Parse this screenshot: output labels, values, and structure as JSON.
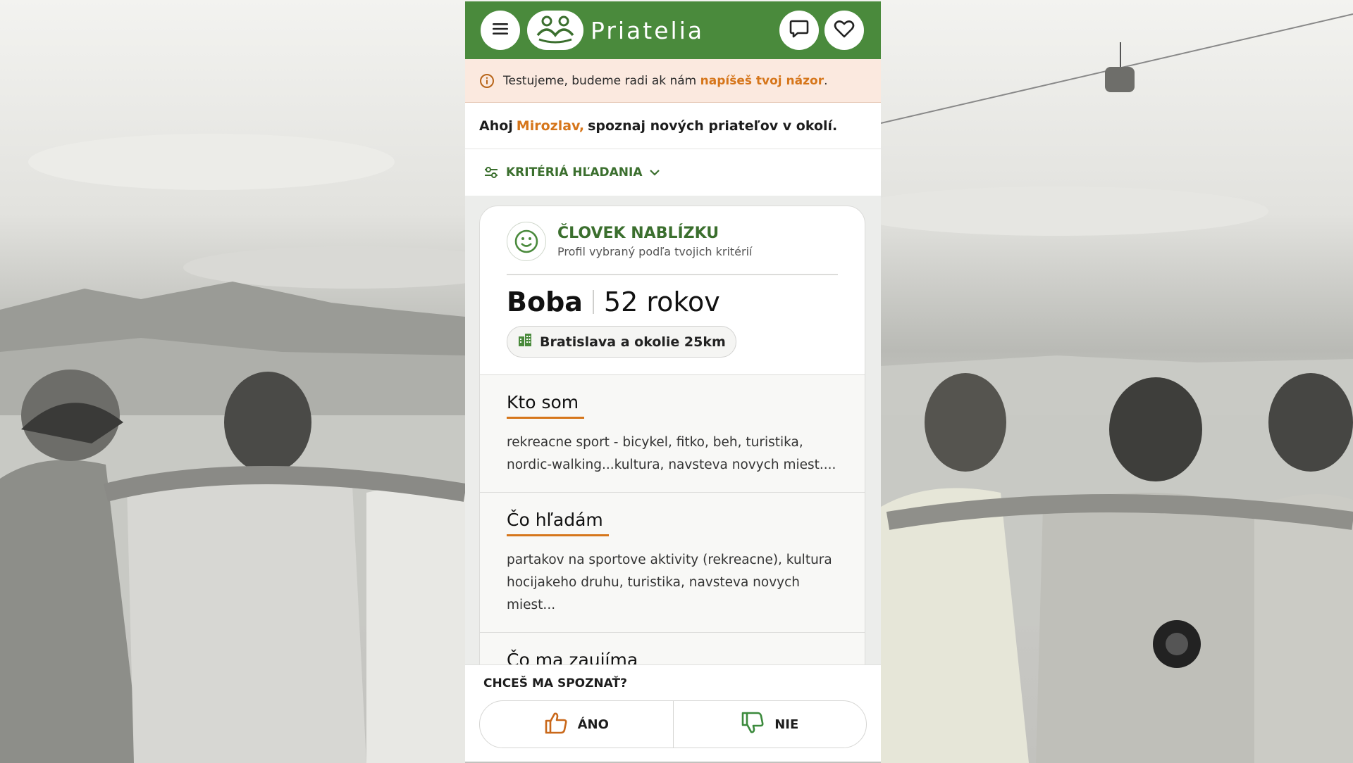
{
  "app": {
    "brand": "Priatelia",
    "colors": {
      "primary": "#4a8a3c",
      "accent": "#d6761b",
      "notice_bg": "#fbe9df"
    }
  },
  "topbar": {
    "menu_icon": "hamburger-icon",
    "logo_icon": "friends-logo-icon",
    "chat_icon": "chat-bubble-icon",
    "favorites_icon": "heart-icon"
  },
  "notice": {
    "text_before": "Testujeme, budeme radi ak nám ",
    "link": "napíšeš tvoj názor",
    "text_after": "."
  },
  "greeting": {
    "hello": "Ahoj",
    "name": "Mirozlav,",
    "rest": "spoznaj nových priateľov v okolí."
  },
  "criteria": {
    "label": "KRITÉRIÁ HĽADANIA"
  },
  "card": {
    "title": "ČLOVEK NABLÍZKU",
    "subtitle": "Profil vybraný podľa tvojich kritérií",
    "name": "Boba",
    "age": "52 rokov",
    "location": "Bratislava a okolie 25km",
    "sections": [
      {
        "title": "Kto som",
        "text": "rekreacne sport - bicykel, fitko, beh, turistika, nordic-walking...kultura, navsteva novych miest...."
      },
      {
        "title": "Čo hľadám",
        "text": "partakov na sportove aktivity (rekreacne), kultura hocijakeho druhu, turistika, navsteva novych miest..."
      },
      {
        "title": "Čo ma zaujíma",
        "text": ""
      }
    ]
  },
  "bottom": {
    "question": "CHCEŠ MA SPOZNAŤ?",
    "yes": "ÁNO",
    "no": "NIE"
  }
}
